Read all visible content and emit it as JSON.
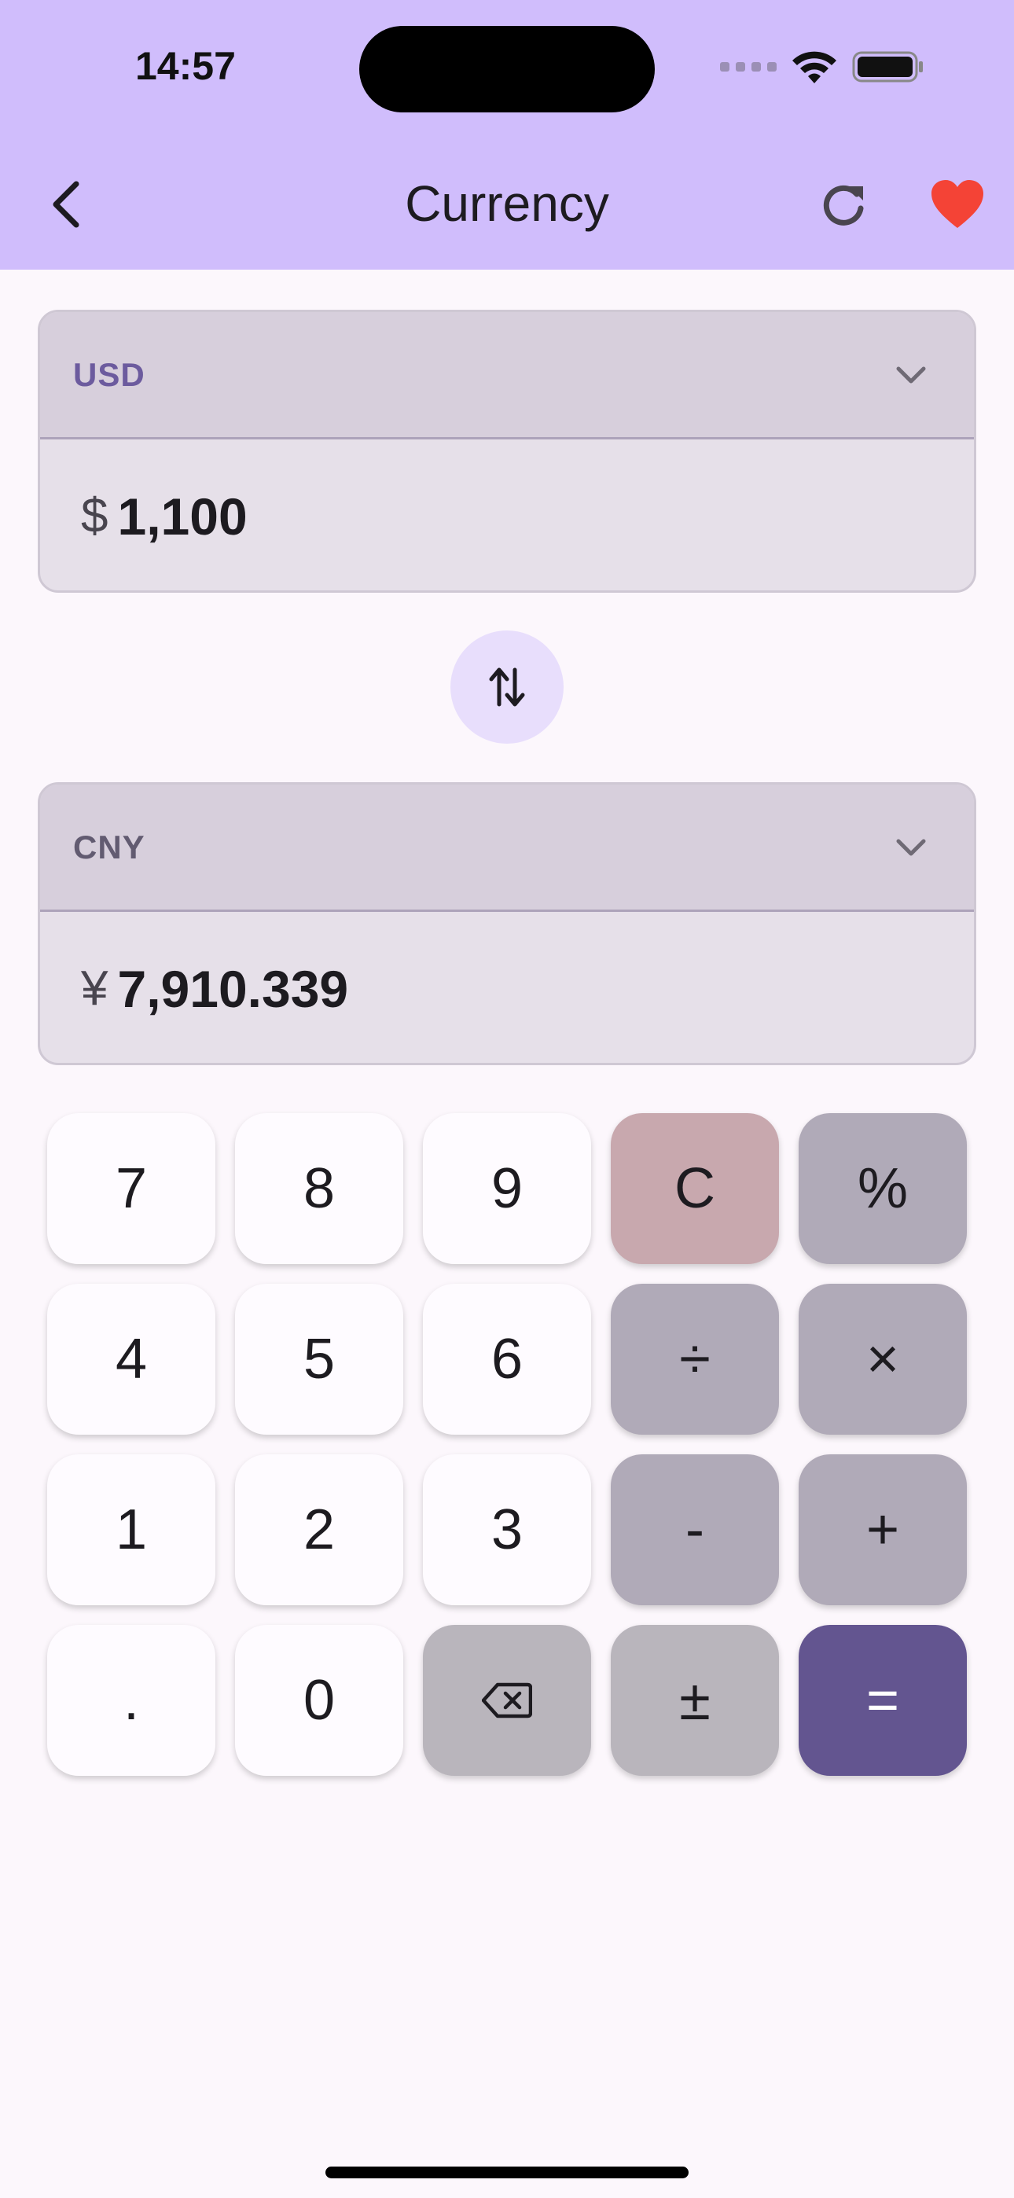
{
  "status_bar": {
    "time": "14:57"
  },
  "nav": {
    "title": "Currency",
    "back_icon": "chevron-left-icon",
    "refresh_icon": "refresh-icon",
    "favorite_icon": "heart-icon"
  },
  "from_currency": {
    "code": "USD",
    "symbol": "$",
    "amount": "1,100"
  },
  "to_currency": {
    "code": "CNY",
    "symbol": "¥",
    "amount": "7,910.339"
  },
  "keypad": {
    "rows": [
      [
        "7",
        "8",
        "9",
        "C",
        "%"
      ],
      [
        "4",
        "5",
        "6",
        "÷",
        "×"
      ],
      [
        "1",
        "2",
        "3",
        "-",
        "+"
      ],
      [
        ".",
        "0",
        "⌫",
        "±",
        "="
      ]
    ]
  },
  "colors": {
    "header_bg": "#D0BDFC",
    "accent": "#635590",
    "usd_code": "#6C5B9E",
    "cny_code": "#625B71",
    "heart": "#F44336"
  }
}
